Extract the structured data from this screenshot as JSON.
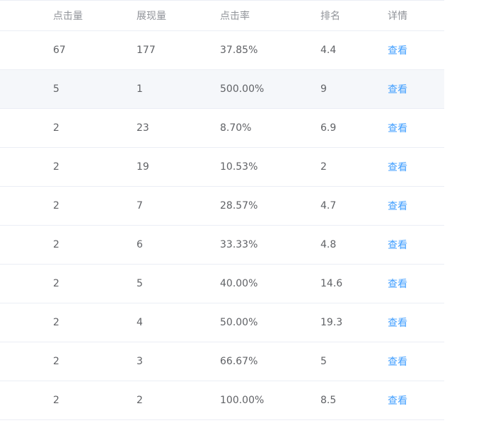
{
  "table": {
    "headers": {
      "clicks": "点击量",
      "impressions": "展现量",
      "ctr": "点击率",
      "rank": "排名",
      "detail": "详情"
    },
    "rows": [
      {
        "clicks": "67",
        "impressions": "177",
        "ctr": "37.85%",
        "rank": "4.4",
        "action": "查看"
      },
      {
        "clicks": "5",
        "impressions": "1",
        "ctr": "500.00%",
        "rank": "9",
        "action": "查看"
      },
      {
        "clicks": "2",
        "impressions": "23",
        "ctr": "8.70%",
        "rank": "6.9",
        "action": "查看"
      },
      {
        "clicks": "2",
        "impressions": "19",
        "ctr": "10.53%",
        "rank": "2",
        "action": "查看"
      },
      {
        "clicks": "2",
        "impressions": "7",
        "ctr": "28.57%",
        "rank": "4.7",
        "action": "查看"
      },
      {
        "clicks": "2",
        "impressions": "6",
        "ctr": "33.33%",
        "rank": "4.8",
        "action": "查看"
      },
      {
        "clicks": "2",
        "impressions": "5",
        "ctr": "40.00%",
        "rank": "14.6",
        "action": "查看"
      },
      {
        "clicks": "2",
        "impressions": "4",
        "ctr": "50.00%",
        "rank": "19.3",
        "action": "查看"
      },
      {
        "clicks": "2",
        "impressions": "3",
        "ctr": "66.67%",
        "rank": "5",
        "action": "查看"
      },
      {
        "clicks": "2",
        "impressions": "2",
        "ctr": "100.00%",
        "rank": "8.5",
        "action": "查看"
      }
    ]
  },
  "colors": {
    "link": "#409eff",
    "header_text": "#909399",
    "cell_text": "#606266",
    "row_hover": "#f5f7fa",
    "border": "#ebeef5"
  }
}
